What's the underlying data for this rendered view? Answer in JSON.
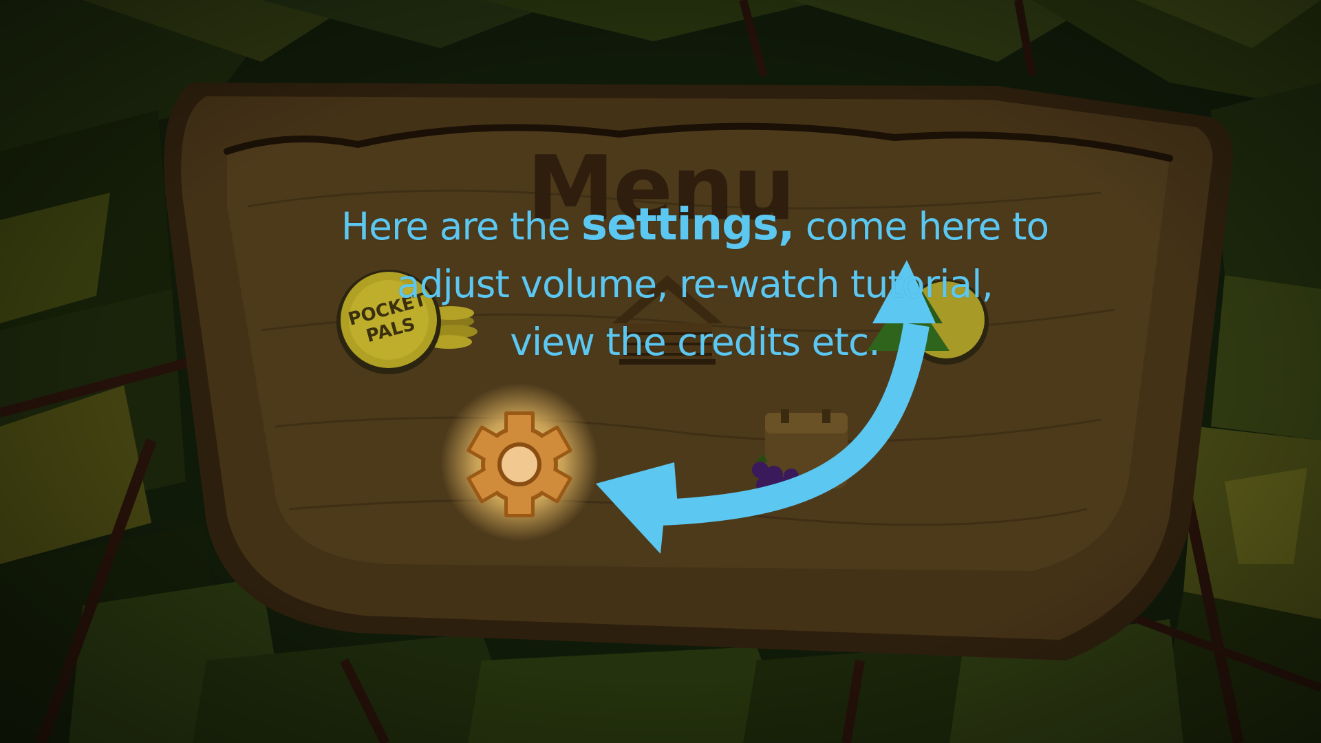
{
  "menu": {
    "title": "Menu",
    "buttons": [
      {
        "id": "pals",
        "icon": "pocket-pals-coin-icon",
        "logo_text": "POCKET PALS"
      },
      {
        "id": "home",
        "icon": "cabin-icon"
      },
      {
        "id": "map",
        "icon": "tree-coin-icon"
      },
      {
        "id": "settings",
        "icon": "gear-icon",
        "highlighted": true
      },
      {
        "id": "backpack",
        "icon": "backpack-icon"
      }
    ]
  },
  "tutorial": {
    "line1_before": "Here are the ",
    "line1_highlight": "settings,",
    "line1_after": " come here to",
    "line2": "adjust volume, re-watch tutorial,",
    "line3": "view the credits etc.",
    "arrow_icon": "curved-arrow-icon"
  },
  "colors": {
    "tutorial_text": "#5cc8f2",
    "sign_wood": "#8a6a3c",
    "highlight_glow": "#f2c46a"
  }
}
